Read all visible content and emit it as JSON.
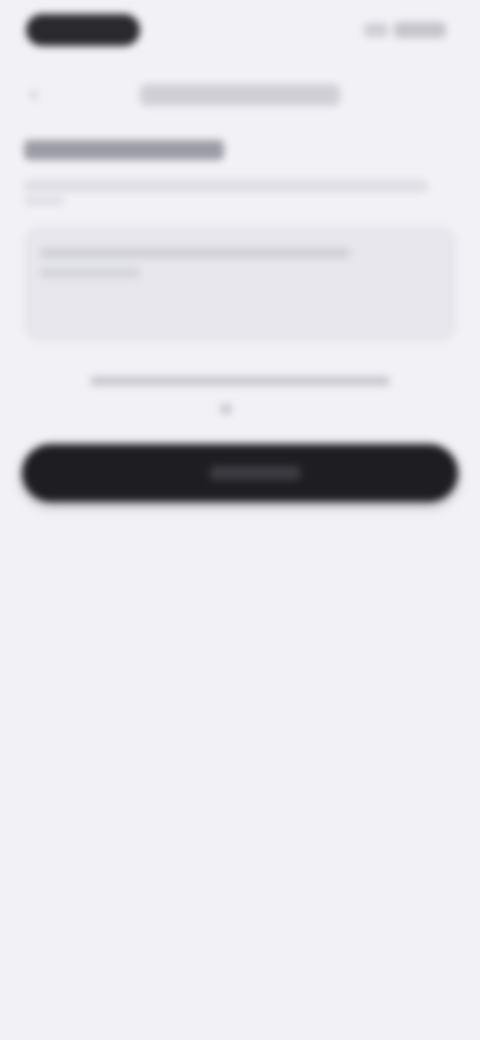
{
  "status_bar": {
    "time": "",
    "battery": ""
  },
  "nav": {
    "title": ""
  },
  "section": {
    "heading": "",
    "description": ""
  },
  "input": {
    "placeholder": ""
  },
  "hint": {
    "text": ""
  },
  "primary_button": {
    "label": ""
  },
  "colors": {
    "background": "#f1f1f6",
    "button": "#1e1e22",
    "field": "#e6e6ec"
  }
}
